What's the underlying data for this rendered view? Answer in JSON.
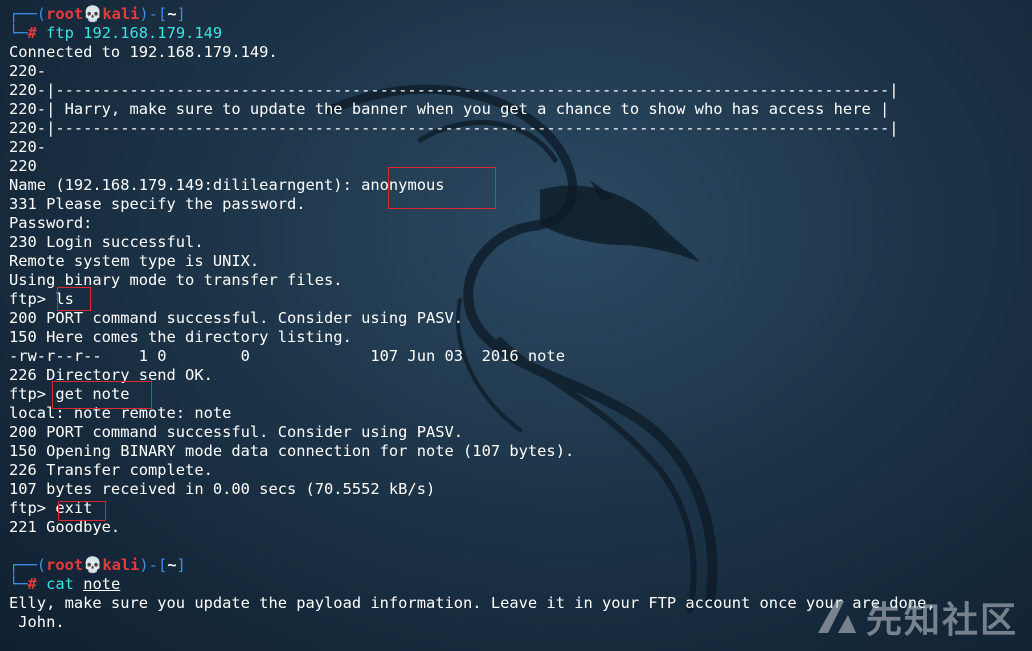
{
  "prompt": {
    "user": "root",
    "host": "kali",
    "dir": "~",
    "skull": "💀"
  },
  "lines": {
    "cmd1": "ftp 192.168.179.149",
    "l1": "Connected to 192.168.179.149.",
    "l2": "220-",
    "l3": "220-|------------------------------------------------------------------------------------------|",
    "l4": "220-| Harry, make sure to update the banner when you get a chance to show who has access here |",
    "l5": "220-|------------------------------------------------------------------------------------------|",
    "l6": "220-",
    "l7": "220",
    "l8a": "Name (192.168.179.149:dililearngent): ",
    "l8b": "anonymous",
    "l9": "331 Please specify the password.",
    "l10": "Password:",
    "l11": "230 Login successful.",
    "l12": "Remote system type is UNIX.",
    "l13": "Using binary mode to transfer files.",
    "ftp_prompt": "ftp> ",
    "ls": "ls",
    "l15": "200 PORT command successful. Consider using PASV.",
    "l16": "150 Here comes the directory listing.",
    "l17": "-rw-r--r--    1 0        0             107 Jun 03  2016 note",
    "l18": "226 Directory send OK.",
    "get": "get note",
    "l20": "local: note remote: note",
    "l21": "200 PORT command successful. Consider using PASV.",
    "l22": "150 Opening BINARY mode data connection for note (107 bytes).",
    "l23": "226 Transfer complete.",
    "l24": "107 bytes received in 0.00 secs (70.5552 kB/s)",
    "exit": "exit",
    "l26": "221 Goodbye.",
    "cmd2_name": "cat",
    "cmd2_arg": "note",
    "l29": "Elly, make sure you update the payload information. Leave it in your FTP account once your are done,",
    "l30": " John."
  },
  "watermark": "先知社区",
  "colors": {
    "prompt_frame": "#3b8ee8",
    "prompt_user": "#e83a3a",
    "command": "#3ce3e3",
    "highlight_box": "#d9282f"
  }
}
